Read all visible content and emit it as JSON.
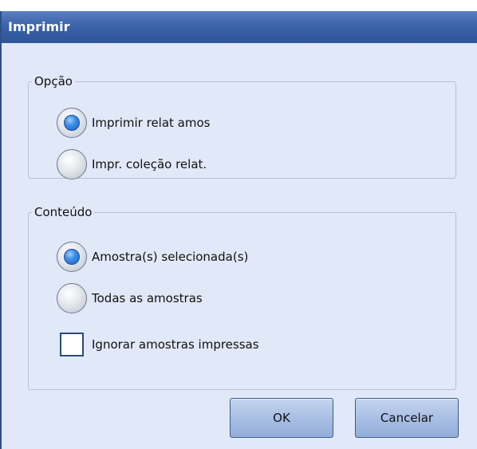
{
  "dialog": {
    "title": "Imprimir"
  },
  "option_group": {
    "legend": "Opção",
    "options": [
      {
        "label": "Imprimir relat amos",
        "checked": true
      },
      {
        "label": "Impr. coleção relat.",
        "checked": false
      }
    ]
  },
  "content_group": {
    "legend": "Conteúdo",
    "options": [
      {
        "label": "Amostra(s) selecionada(s)",
        "checked": true
      },
      {
        "label": "Todas as amostras",
        "checked": false
      }
    ],
    "checkbox": {
      "label": "Ignorar amostras impressas",
      "checked": false
    }
  },
  "buttons": {
    "ok_label": "OK",
    "cancel_label": "Cancelar"
  },
  "colors": {
    "titlebar": "#3a63a8",
    "dialog_background": "#e1e8f7",
    "radio_selected": "#3d8fe6"
  }
}
